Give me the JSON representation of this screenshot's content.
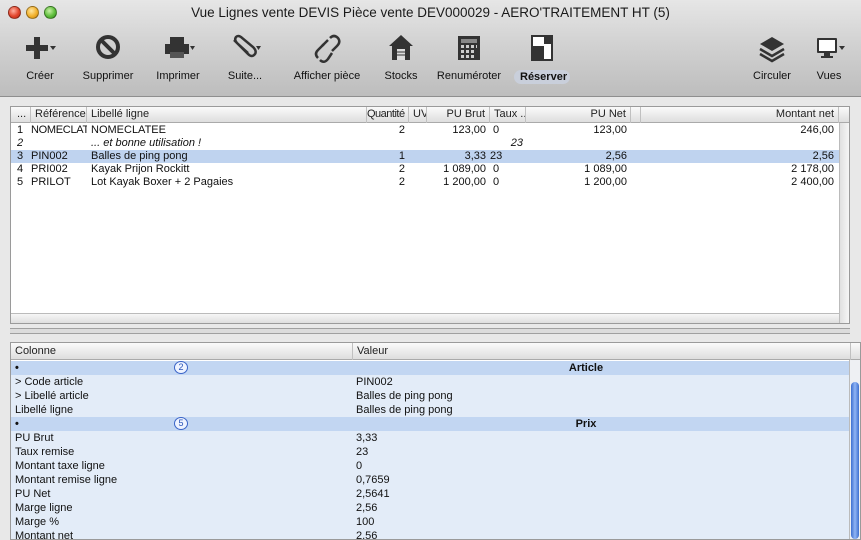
{
  "window": {
    "title": "Vue Lignes vente DEVIS Pièce vente DEV000029 - AERO'TRAITEMENT HT (5)"
  },
  "toolbar": {
    "create": "Créer",
    "delete": "Supprimer",
    "print": "Imprimer",
    "next": "Suite...",
    "show_piece": "Afficher pièce",
    "stocks": "Stocks",
    "renumber": "Renuméroter",
    "reserve": "Réserver",
    "circulate": "Circuler",
    "views": "Vues"
  },
  "lines_table": {
    "headers": {
      "idx": "...",
      "reference": "Référence",
      "label": "Libellé ligne",
      "qty": "Quantité",
      "uv": "UV",
      "pu_brut": "PU Brut",
      "taux": "Taux ...",
      "pu_net": "PU Net",
      "montant": "Montant net"
    },
    "rows": [
      {
        "idx": "1",
        "reference": "NOMECLAT...",
        "label": "NOMECLATEE",
        "qty": "2",
        "pu_brut": "123,00",
        "taux": "0",
        "pu_net": "123,00",
        "montant": "246,00"
      },
      {
        "idx": "2",
        "reference": "",
        "label": "... et bonne utilisation !",
        "qty": "",
        "pu_brut": "",
        "taux": "23",
        "pu_net": "",
        "montant": ""
      },
      {
        "idx": "3",
        "reference": "PIN002",
        "label": "Balles de ping pong",
        "qty": "1",
        "pu_brut": "3,33",
        "taux": "23",
        "pu_net": "2,56",
        "montant": "2,56"
      },
      {
        "idx": "4",
        "reference": "PRI002",
        "label": "Kayak Prijon Rockitt",
        "qty": "2",
        "pu_brut": "1 089,00",
        "taux": "0",
        "pu_net": "1 089,00",
        "montant": "2 178,00"
      },
      {
        "idx": "5",
        "reference": "PRILOT",
        "label": "Lot Kayak Boxer + 2 Pagaies",
        "qty": "2",
        "pu_brut": "1 200,00",
        "taux": "0",
        "pu_net": "1 200,00",
        "montant": "2 400,00"
      }
    ],
    "selected_index": 2
  },
  "properties": {
    "headers": {
      "column": "Colonne",
      "value": "Valeur"
    },
    "rows": [
      {
        "kind": "group",
        "bullet": "•",
        "badge": "2",
        "value": "Article"
      },
      {
        "kind": "item",
        "name": "> Code article",
        "value": "PIN002"
      },
      {
        "kind": "item",
        "name": "> Libellé article",
        "value": "Balles de ping pong"
      },
      {
        "kind": "item",
        "name": "Libellé ligne",
        "value": "Balles de ping pong"
      },
      {
        "kind": "group",
        "bullet": "•",
        "badge": "5",
        "value": "Prix"
      },
      {
        "kind": "item",
        "name": "PU Brut",
        "value": "3,33"
      },
      {
        "kind": "item",
        "name": "Taux remise",
        "value": "23"
      },
      {
        "kind": "item",
        "name": "Montant taxe ligne",
        "value": "0"
      },
      {
        "kind": "item",
        "name": "Montant remise ligne",
        "value": "0,7659"
      },
      {
        "kind": "item",
        "name": "PU Net",
        "value": "2,5641"
      },
      {
        "kind": "item",
        "name": "Marge ligne",
        "value": "2,56"
      },
      {
        "kind": "item",
        "name": "Marge %",
        "value": "100"
      },
      {
        "kind": "item",
        "name": "Montant net",
        "value": "2,56"
      }
    ]
  },
  "colors": {
    "selection": "#bfd3ef",
    "group_row": "#c2d6f2",
    "alt_row": "#e3ecf8",
    "accent": "#3d6fd0"
  }
}
